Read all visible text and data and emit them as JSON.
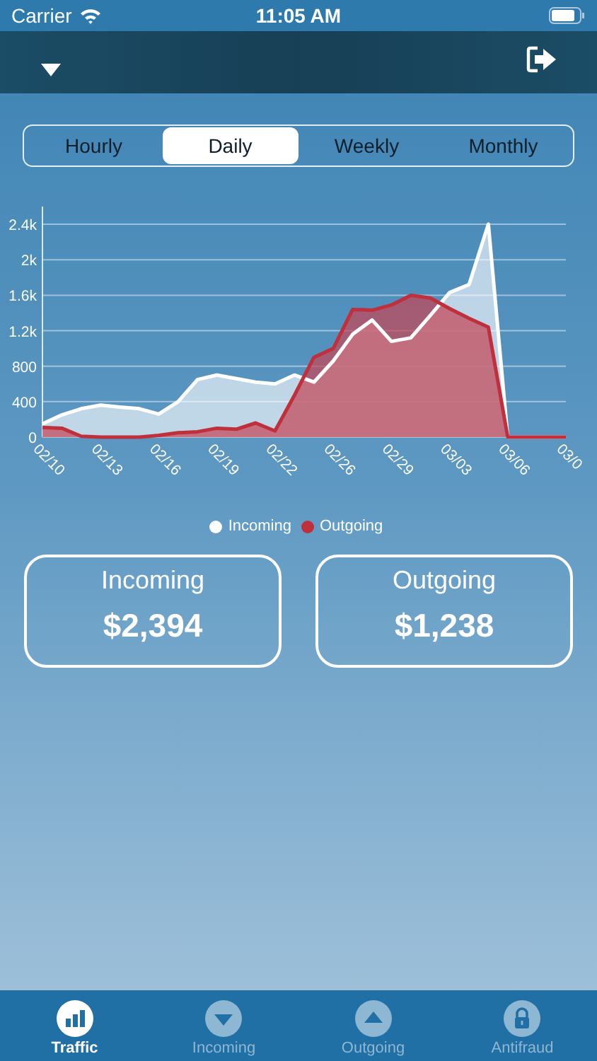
{
  "status_bar": {
    "carrier": "Carrier",
    "time": "11:05 AM"
  },
  "segments": [
    {
      "label": "Hourly",
      "selected": false
    },
    {
      "label": "Daily",
      "selected": true
    },
    {
      "label": "Weekly",
      "selected": false
    },
    {
      "label": "Monthly",
      "selected": false
    }
  ],
  "chart_data": {
    "type": "area",
    "grid": true,
    "categories": [
      "02/10",
      null,
      null,
      "02/13",
      null,
      null,
      "02/16",
      null,
      null,
      "02/19",
      null,
      null,
      "02/22",
      null,
      null,
      "02/26",
      null,
      null,
      "02/29",
      null,
      null,
      "03/03",
      null,
      null,
      "03/06",
      null,
      null,
      "03/0"
    ],
    "ylim": [
      0,
      2600
    ],
    "yticks": [
      {
        "value": 0,
        "label": "0"
      },
      {
        "value": 400,
        "label": "400"
      },
      {
        "value": 800,
        "label": "800"
      },
      {
        "value": 1200,
        "label": "1.2k"
      },
      {
        "value": 1600,
        "label": "1.6k"
      },
      {
        "value": 2000,
        "label": "2k"
      },
      {
        "value": 2400,
        "label": "2.4k"
      }
    ],
    "series": [
      {
        "name": "Incoming",
        "color": "#ffffff",
        "values": [
          150,
          250,
          320,
          360,
          340,
          320,
          260,
          400,
          650,
          700,
          660,
          620,
          600,
          700,
          620,
          860,
          1160,
          1320,
          1080,
          1120,
          1370,
          1630,
          1720,
          2400,
          0,
          0,
          0,
          0
        ]
      },
      {
        "name": "Outgoing",
        "color": "#c0303c",
        "values": [
          110,
          100,
          10,
          0,
          0,
          0,
          20,
          50,
          60,
          100,
          90,
          160,
          70,
          470,
          900,
          1000,
          1440,
          1430,
          1490,
          1600,
          1570,
          1450,
          1340,
          1240,
          0,
          0,
          0,
          0
        ]
      }
    ]
  },
  "cards": [
    {
      "title": "Incoming",
      "amount": "$2,394"
    },
    {
      "title": "Outgoing",
      "amount": "$1,238"
    }
  ],
  "tabs": [
    {
      "label": "Traffic",
      "kind": "bars",
      "selected": true
    },
    {
      "label": "Incoming",
      "kind": "down",
      "selected": false
    },
    {
      "label": "Outgoing",
      "kind": "up",
      "selected": false
    },
    {
      "label": "Antifraud",
      "kind": "lock",
      "selected": false
    }
  ]
}
